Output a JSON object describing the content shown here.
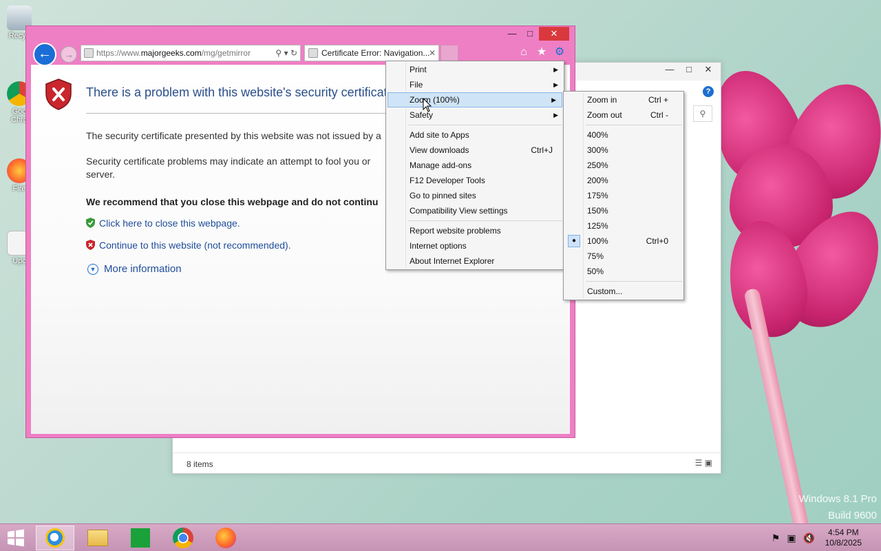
{
  "desktop": {
    "icons": [
      {
        "label": "Recyc"
      },
      {
        "label": "Goo Chro"
      },
      {
        "label": "Fire"
      },
      {
        "label": "Upc"
      }
    ],
    "watermark_line1": "Windows 8.1 Pro",
    "watermark_line2": "Build 9600"
  },
  "explorer": {
    "status": "8 items",
    "help_label": "?"
  },
  "ie": {
    "address": {
      "prefix": "https://www.",
      "domain": "majorgeeks.com",
      "path": "/mg/getmirror"
    },
    "tab_title": "Certificate Error: Navigation...",
    "page": {
      "title": "There is a problem with this website's security certificate",
      "para1": "The security certificate presented by this website was not issued by a",
      "para2": "Security certificate problems may indicate an attempt to fool you or",
      "para2b": "server.",
      "recommend": "We recommend that you close this webpage and do not continu",
      "link_close": "Click here to close this webpage.",
      "link_continue": "Continue to this website (not recommended).",
      "more_info": "More information"
    }
  },
  "tools_menu": {
    "items": [
      {
        "label": "Print",
        "submenu": true
      },
      {
        "label": "File",
        "submenu": true
      },
      {
        "label": "Zoom (100%)",
        "submenu": true
      },
      {
        "label": "Safety",
        "submenu": true
      },
      {
        "label": "Add site to Apps"
      },
      {
        "label": "View downloads",
        "shortcut": "Ctrl+J"
      },
      {
        "label": "Manage add-ons"
      },
      {
        "label": "F12 Developer Tools"
      },
      {
        "label": "Go to pinned sites"
      },
      {
        "label": "Compatibility View settings"
      },
      {
        "label": "Report website problems"
      },
      {
        "label": "Internet options"
      },
      {
        "label": "About Internet Explorer"
      }
    ]
  },
  "zoom_menu": {
    "items": [
      {
        "label": "Zoom in",
        "shortcut": "Ctrl +"
      },
      {
        "label": "Zoom out",
        "shortcut": "Ctrl -"
      },
      {
        "label": "400%"
      },
      {
        "label": "300%"
      },
      {
        "label": "250%"
      },
      {
        "label": "200%"
      },
      {
        "label": "175%"
      },
      {
        "label": "150%"
      },
      {
        "label": "125%"
      },
      {
        "label": "100%",
        "shortcut": "Ctrl+0",
        "checked": true
      },
      {
        "label": "75%"
      },
      {
        "label": "50%"
      },
      {
        "label": "Custom..."
      }
    ]
  },
  "taskbar": {
    "clock_time": "4:54 PM",
    "clock_date": "10/8/2025"
  }
}
